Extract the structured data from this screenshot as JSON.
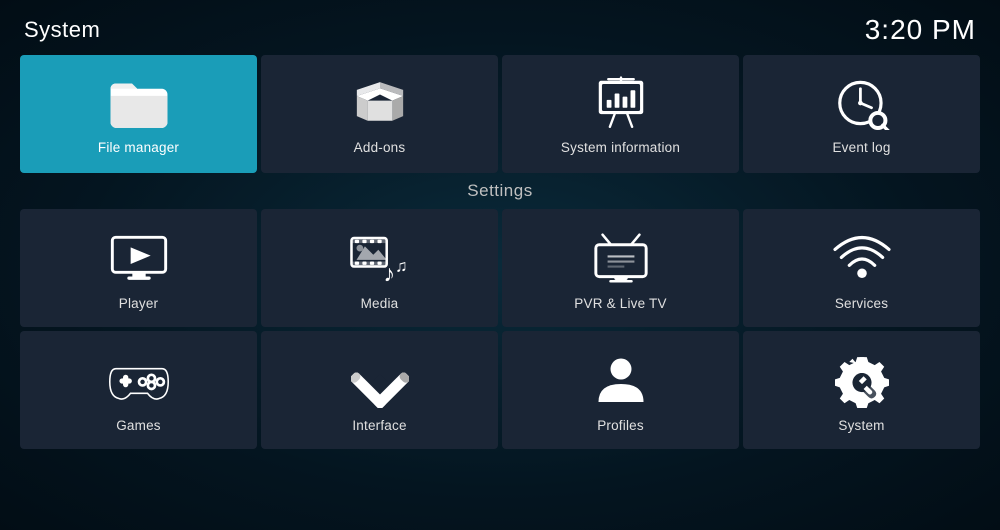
{
  "header": {
    "title": "System",
    "time": "3:20 PM"
  },
  "top_row": [
    {
      "id": "file-manager",
      "label": "File manager",
      "active": true
    },
    {
      "id": "add-ons",
      "label": "Add-ons",
      "active": false
    },
    {
      "id": "system-information",
      "label": "System information",
      "active": false
    },
    {
      "id": "event-log",
      "label": "Event log",
      "active": false
    }
  ],
  "settings": {
    "title": "Settings",
    "items": [
      {
        "id": "player",
        "label": "Player"
      },
      {
        "id": "media",
        "label": "Media"
      },
      {
        "id": "pvr-live-tv",
        "label": "PVR & Live TV"
      },
      {
        "id": "services",
        "label": "Services"
      },
      {
        "id": "games",
        "label": "Games"
      },
      {
        "id": "interface",
        "label": "Interface"
      },
      {
        "id": "profiles",
        "label": "Profiles"
      },
      {
        "id": "system",
        "label": "System"
      }
    ]
  }
}
